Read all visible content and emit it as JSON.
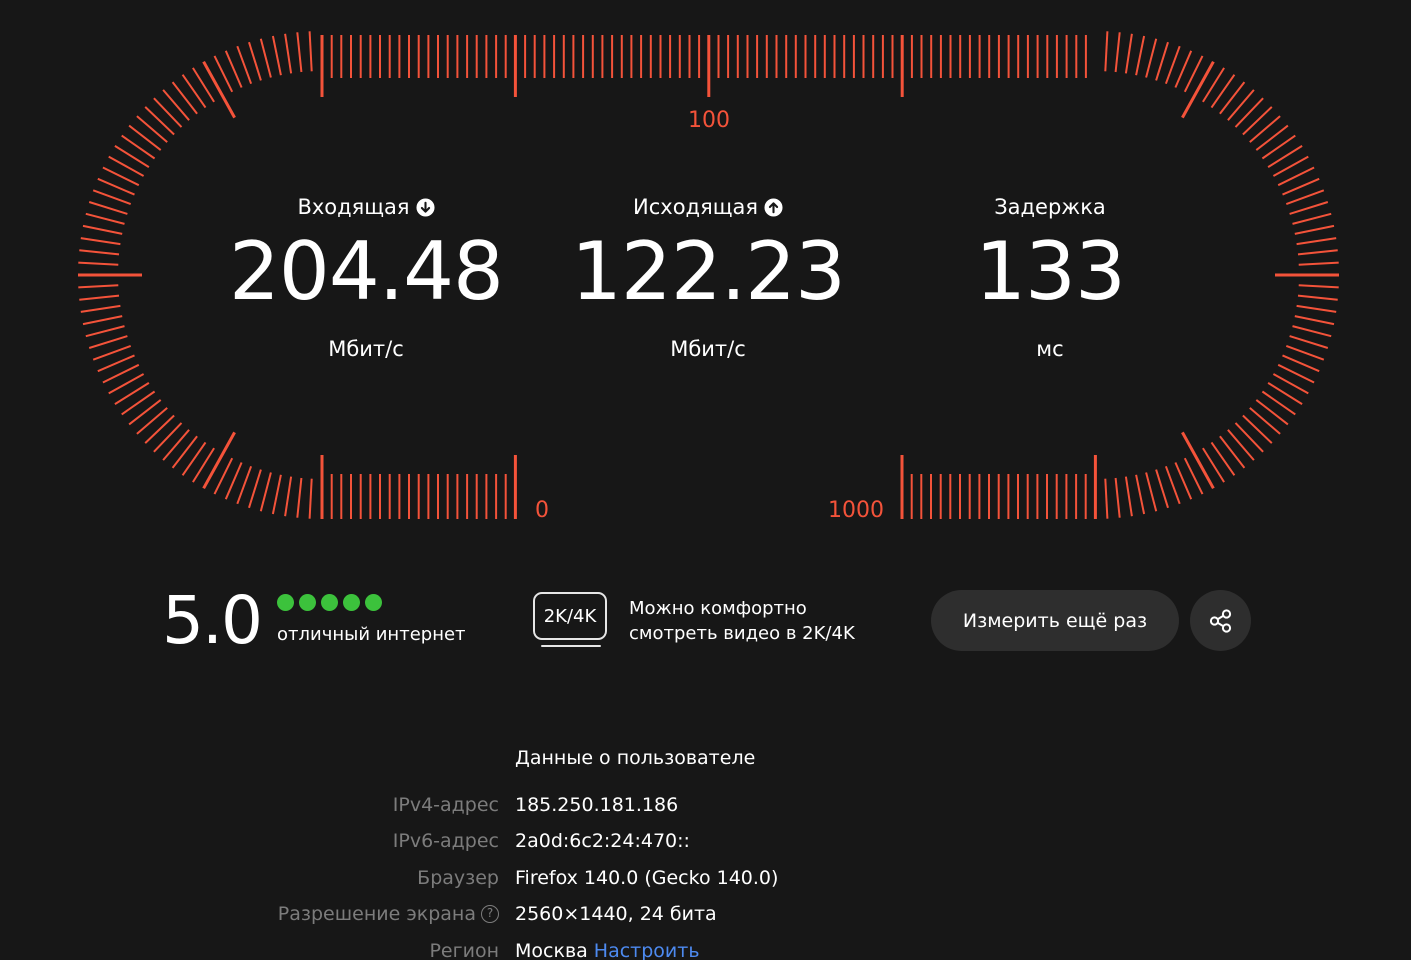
{
  "colors": {
    "accent": "#f4533a",
    "background": "#171717",
    "rating_dot": "#3cc23c",
    "link": "#4d8af0",
    "muted": "#7c7c7c",
    "button_bg": "#2e2e2e"
  },
  "gauge": {
    "label_top": "100",
    "label_left_bottom": "0",
    "label_right_bottom": "1000"
  },
  "metrics": {
    "download": {
      "title": "Входящая",
      "icon": "arrow-down-circle-icon",
      "value": "204.48",
      "unit": "Мбит/с"
    },
    "upload": {
      "title": "Исходящая",
      "icon": "arrow-up-circle-icon",
      "value": "122.23",
      "unit": "Мбит/с"
    },
    "latency": {
      "title": "Задержка",
      "value": "133",
      "unit": "мс"
    }
  },
  "rating": {
    "value": "5.0",
    "dots_filled": 5,
    "dots_total": 5,
    "text": "отличный интернет"
  },
  "quality": {
    "badge": "2K/4K",
    "line1": "Можно комфортно",
    "line2": "смотреть видео в 2K/4K"
  },
  "actions": {
    "retest_label": "Измерить ещё раз",
    "share_icon": "share-icon"
  },
  "user_info": {
    "heading": "Данные о пользователе",
    "rows": [
      {
        "label": "IPv4-адрес",
        "value": "185.250.181.186"
      },
      {
        "label": "IPv6-адрес",
        "value": "2a0d:6c2:24:470::"
      },
      {
        "label": "Браузер",
        "value": "Firefox 140.0 (Gecko 140.0)"
      },
      {
        "label": "Разрешение экрана",
        "value": "2560×1440, 24 бита",
        "help_icon": "question-circle-icon"
      },
      {
        "label": "Регион",
        "value": "Москва",
        "link": "Настроить"
      }
    ]
  }
}
